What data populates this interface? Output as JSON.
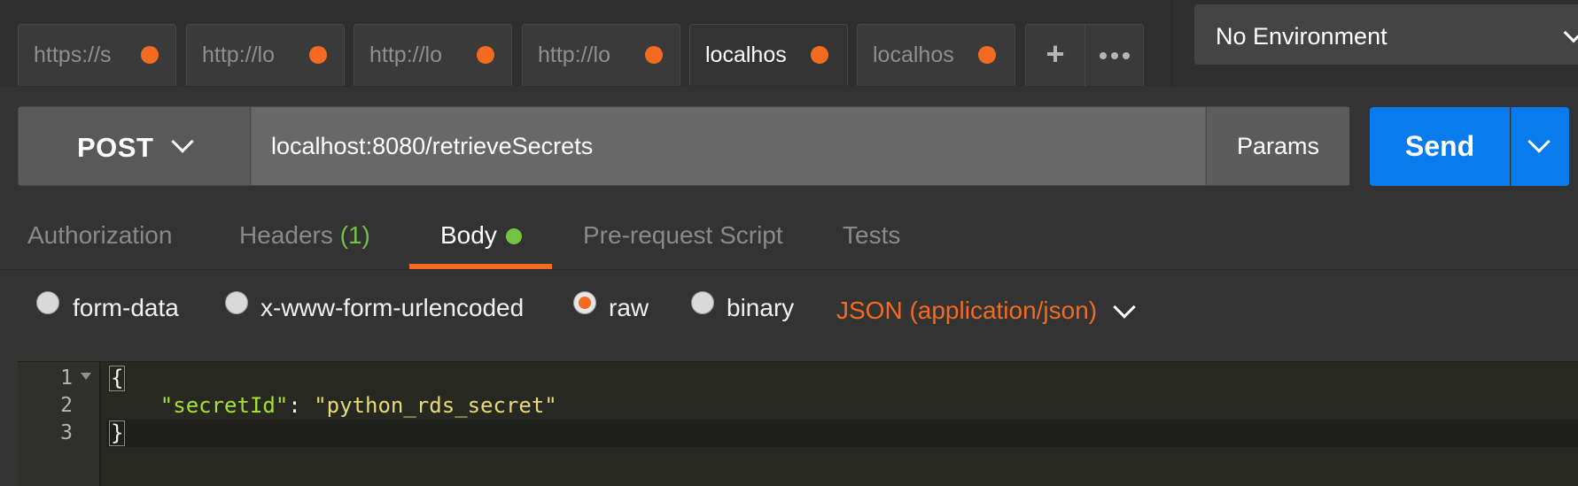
{
  "tabs": [
    {
      "label": "https://s",
      "modified": true,
      "active": false
    },
    {
      "label": "http://lo",
      "modified": true,
      "active": false
    },
    {
      "label": "http://lo",
      "modified": true,
      "active": false
    },
    {
      "label": "http://lo",
      "modified": true,
      "active": false
    },
    {
      "label": "localhos",
      "modified": true,
      "active": true
    },
    {
      "label": "localhos",
      "modified": true,
      "active": false
    }
  ],
  "tab_actions": {
    "plus_icon": "plus-icon",
    "more_icon": "more-icon"
  },
  "environment": {
    "selected": "No Environment"
  },
  "request": {
    "method": "POST",
    "url": "localhost:8080/retrieveSecrets",
    "params_label": "Params",
    "send_label": "Send"
  },
  "subtabs": {
    "authorization": "Authorization",
    "headers": "Headers",
    "headers_count": "(1)",
    "body": "Body",
    "prerequest": "Pre-request Script",
    "tests": "Tests"
  },
  "body_modes": {
    "form_data": "form-data",
    "urlencoded": "x-www-form-urlencoded",
    "raw": "raw",
    "binary": "binary",
    "selected": "raw",
    "content_type": "JSON (application/json)"
  },
  "editor": {
    "line_numbers": [
      "1",
      "2",
      "3"
    ],
    "line1": "{",
    "line2_indent": "    ",
    "line2_key": "\"secretId\"",
    "line2_sep": ": ",
    "line2_value": "\"python_rds_secret\"",
    "line3": "}"
  },
  "colors": {
    "accent": "#f26b21",
    "send_blue": "#097bed",
    "success_green": "#71c341"
  }
}
